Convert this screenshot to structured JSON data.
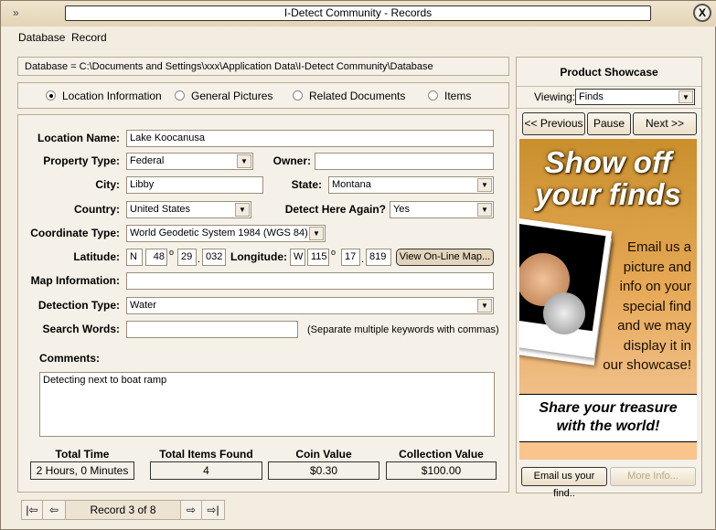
{
  "window": {
    "title": "I-Detect Community - Records",
    "app_icon": "chevron-icon",
    "close": "X"
  },
  "menu": [
    "Database",
    "Record"
  ],
  "path": "Database = C:\\Documents and Settings\\xxx\\Application Data\\I-Detect Community\\Database",
  "tabs": [
    {
      "label": "Location Information",
      "selected": true
    },
    {
      "label": "General Pictures",
      "selected": false
    },
    {
      "label": "Related Documents",
      "selected": false
    },
    {
      "label": "Items",
      "selected": false
    }
  ],
  "form": {
    "location_name": {
      "label": "Location Name:",
      "value": "Lake Koocanusa"
    },
    "property_type": {
      "label": "Property Type:",
      "value": "Federal"
    },
    "owner": {
      "label": "Owner:",
      "value": ""
    },
    "city": {
      "label": "City:",
      "value": "Libby"
    },
    "state": {
      "label": "State:",
      "value": "Montana"
    },
    "country": {
      "label": "Country:",
      "value": "United States"
    },
    "detect_again": {
      "label": "Detect Here Again?",
      "value": "Yes"
    },
    "coordinate_type": {
      "label": "Coordinate Type:",
      "value": "World Geodetic System 1984 (WGS 84)"
    },
    "latitude": {
      "label": "Latitude:",
      "hemi": "N",
      "deg": "48",
      "min": "29",
      "dec": "032"
    },
    "longitude": {
      "label": "Longitude:",
      "hemi": "W",
      "deg": "115",
      "min": "17",
      "dec": "819"
    },
    "degree_symbol": "o",
    "dot": ".",
    "map_button": "View On-Line Map...",
    "map_information": {
      "label": "Map Information:",
      "value": ""
    },
    "detection_type": {
      "label": "Detection Type:",
      "value": "Water"
    },
    "search_words": {
      "label": "Search Words:",
      "value": "",
      "hint": "(Separate multiple keywords with commas)"
    },
    "comments": {
      "label": "Comments:",
      "value": "Detecting next to boat ramp"
    }
  },
  "summary": [
    {
      "label": "Total Time",
      "value": "2 Hours, 0 Minutes"
    },
    {
      "label": "Total Items Found",
      "value": "4"
    },
    {
      "label": "Coin Value",
      "value": "$0.30"
    },
    {
      "label": "Collection Value",
      "value": "$100.00"
    }
  ],
  "record_nav": {
    "label": "Record 3 of 8"
  },
  "showcase": {
    "title": "Product Showcase",
    "viewing_label": "Viewing:",
    "viewing_value": "Finds",
    "prev": "<< Previous",
    "pause": "Pause",
    "next": "Next >>",
    "ad": {
      "headline1": "Show off",
      "headline2": "your finds",
      "body": [
        "Email us a",
        "picture and",
        "info on your",
        "special find",
        "and we may",
        "display it in",
        "our showcase!"
      ],
      "tagline1": "Share your treasure",
      "tagline2": "with the world!"
    },
    "email_button": "Email us your find..",
    "more_button": "More Info..."
  }
}
